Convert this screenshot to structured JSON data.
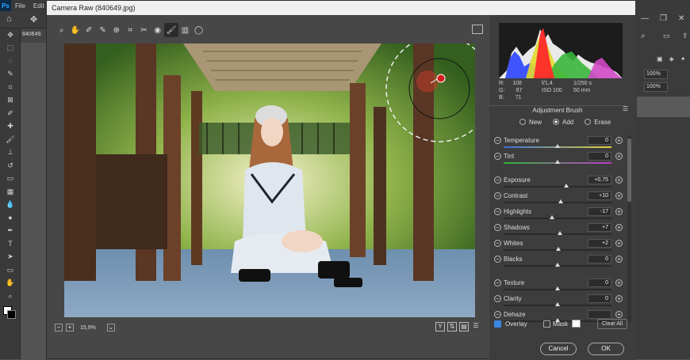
{
  "menubar": {
    "logo": "Ps",
    "items": [
      "File",
      "Edit"
    ]
  },
  "doc_tab": "840649.",
  "ps_tools": [
    "move-tool",
    "marquee-tool",
    "lasso-tool",
    "quick-select-tool",
    "crop-tool",
    "frame-tool",
    "eyedropper-tool",
    "healing-tool",
    "brush-tool",
    "stamp-tool",
    "history-brush-tool",
    "eraser-tool",
    "gradient-tool",
    "blur-tool",
    "dodge-tool",
    "pen-tool",
    "type-tool",
    "path-select-tool",
    "shape-tool",
    "hand-tool",
    "zoom-tool"
  ],
  "right_panel": {
    "zoom1": "100%",
    "zoom2": "100%"
  },
  "camera_raw": {
    "title": "Camera Raw (840649.jpg)",
    "toolbar": [
      "zoom-icon",
      "hand-icon",
      "white-balance-icon",
      "color-sampler-icon",
      "targeted-adjust-icon",
      "straighten-icon",
      "spot-removal-icon",
      "red-eye-icon",
      "adjustment-brush-icon",
      "graduated-filter-icon",
      "radial-filter-icon"
    ],
    "active_tool": "adjustment-brush-icon",
    "zoom_level": "15,9%",
    "readout": {
      "r_label": "R:",
      "r": "108",
      "g_label": "G:",
      "g": "97",
      "b_label": "B:",
      "b": "71",
      "aperture": "f/1,4",
      "shutter": "1/250 s",
      "iso": "ISO 100",
      "focal": "50 mm"
    },
    "panel_title": "Adjustment Brush",
    "modes": [
      "New",
      "Add",
      "Erase"
    ],
    "selected_mode": "Add",
    "sliders": [
      {
        "label": "Temperature",
        "value": "0",
        "pos": 0.5,
        "track": "temp"
      },
      {
        "label": "Tint",
        "value": "0",
        "pos": 0.5,
        "track": "tint"
      },
      {
        "label": "Exposure",
        "value": "+0,75",
        "pos": 0.58,
        "track": "plain"
      },
      {
        "label": "Contrast",
        "value": "+10",
        "pos": 0.53,
        "track": "plain"
      },
      {
        "label": "Highlights",
        "value": "-17",
        "pos": 0.45,
        "track": "plain"
      },
      {
        "label": "Shadows",
        "value": "+7",
        "pos": 0.52,
        "track": "plain"
      },
      {
        "label": "Whites",
        "value": "+2",
        "pos": 0.51,
        "track": "plain"
      },
      {
        "label": "Blacks",
        "value": "0",
        "pos": 0.5,
        "track": "plain"
      },
      {
        "label": "Texture",
        "value": "0",
        "pos": 0.5,
        "track": "plain"
      },
      {
        "label": "Clarity",
        "value": "0",
        "pos": 0.5,
        "track": "plain"
      },
      {
        "label": "Dehaze",
        "value": "",
        "pos": 0.5,
        "track": "plain"
      }
    ],
    "overlay_label": "Overlay",
    "overlay_checked": true,
    "mask_label": "Mask",
    "mask_checked": false,
    "clear_all": "Clear All",
    "cancel": "Cancel",
    "ok": "OK"
  },
  "colors": {
    "accent": "#3a86e0",
    "panel": "#3d3d3d",
    "window": "#474747"
  }
}
